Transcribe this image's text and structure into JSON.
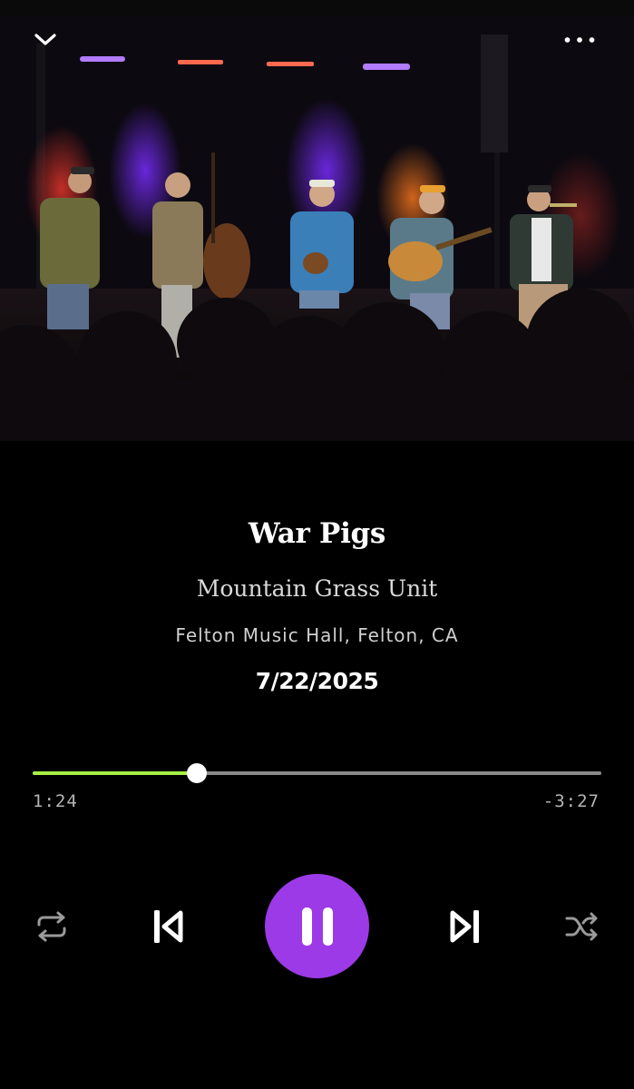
{
  "header": {
    "collapse_icon": "chevron-down-icon",
    "more_icon": "more-horizontal-icon"
  },
  "artwork": {
    "kind": "concert-photo"
  },
  "track": {
    "title": "War Pigs",
    "artist": "Mountain Grass Unit",
    "venue": "Felton Music Hall, Felton, CA",
    "date": "7/22/2025"
  },
  "playback": {
    "elapsed": "1:24",
    "remaining": "-3:27",
    "progress": 0.289,
    "state": "playing"
  },
  "controls": {
    "repeat_icon": "repeat-icon",
    "previous_icon": "skip-previous-icon",
    "play_pause_icon": "pause-icon",
    "next_icon": "skip-next-icon",
    "shuffle_icon": "shuffle-icon"
  },
  "colors": {
    "background": "#000000",
    "accent": "#9b3ae6",
    "progress": "#a6f046",
    "track": "#8a8a8a"
  }
}
